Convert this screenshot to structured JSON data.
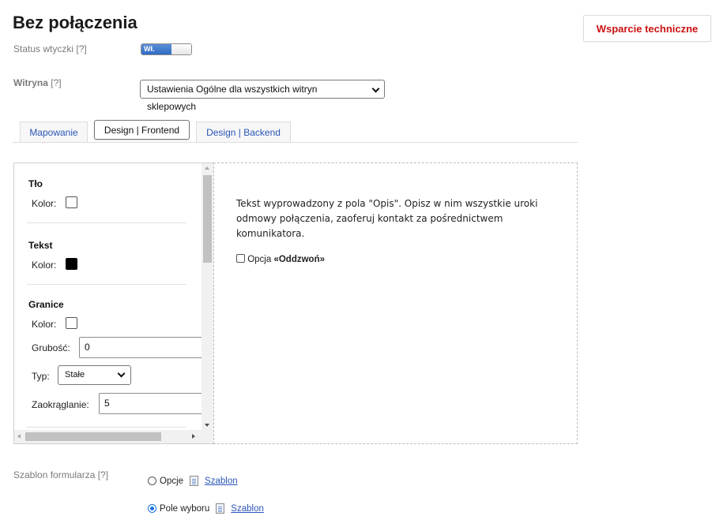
{
  "header": {
    "title": "Bez połączenia",
    "support_button": "Wsparcie techniczne"
  },
  "status": {
    "label": "Status wtyczki [?]",
    "toggle_on_text": "Wł."
  },
  "site": {
    "label_main": "Witryna",
    "label_help": "[?]",
    "selected": "Ustawienia Ogólne dla wszystkich witryn sklepowych"
  },
  "tabs": [
    {
      "label": "Mapowanie"
    },
    {
      "label": "Design | Frontend"
    },
    {
      "label": "Design | Backend"
    }
  ],
  "design": {
    "background": {
      "title": "Tło",
      "color_label": "Kolor:",
      "color": "#ffffff"
    },
    "text": {
      "title": "Tekst",
      "color_label": "Kolor:",
      "color": "#000000"
    },
    "border": {
      "title": "Granice",
      "color_label": "Kolor:",
      "color": "#ffffff",
      "thickness_label": "Grubość:",
      "thickness_value": "0",
      "type_label": "Typ:",
      "type_value": "Stałe",
      "radius_label": "Zaokrąglanie:",
      "radius_value": "5"
    }
  },
  "preview": {
    "description": "Tekst wyprowadzony z pola \"Opis\". Opisz w nim wszystkie uroki odmowy połączenia, zaoferuj kontakt za pośrednictwem komunikatora.",
    "option_prefix": "Opcja",
    "option_bold": "«Oddzwoń»"
  },
  "form_template": {
    "label": "Szablon formularza [?]",
    "options": [
      {
        "label": "Opcje",
        "link": "Szablon",
        "checked": false
      },
      {
        "label": "Pole wyboru",
        "link": "Szablon",
        "checked": true
      }
    ]
  }
}
